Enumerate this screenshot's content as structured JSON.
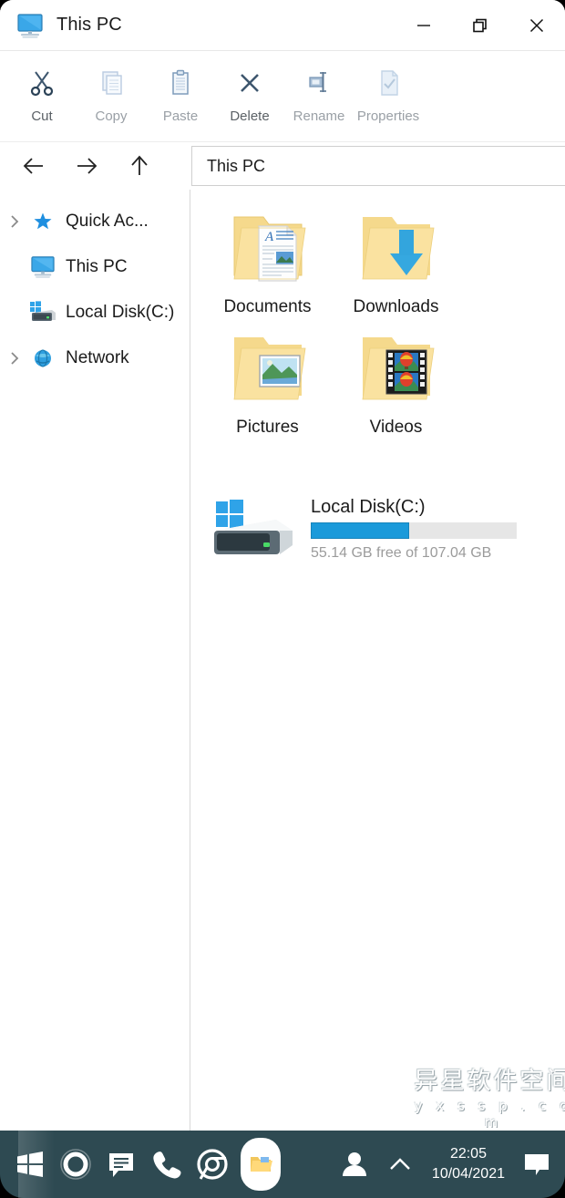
{
  "window": {
    "title": "This PC",
    "title_icon": "this-pc-monitor-icon",
    "controls": {
      "minimize": "minimize-icon",
      "restore": "restore-icon",
      "close": "close-icon"
    }
  },
  "toolbar": {
    "items": [
      {
        "label": "Cut",
        "icon": "scissors-icon",
        "enabled": true
      },
      {
        "label": "Copy",
        "icon": "copy-icon",
        "enabled": false
      },
      {
        "label": "Paste",
        "icon": "clipboard-icon",
        "enabled": false
      },
      {
        "label": "Delete",
        "icon": "x-delete-icon",
        "enabled": true
      },
      {
        "label": "Rename",
        "icon": "rename-icon",
        "enabled": false
      },
      {
        "label": "Properties",
        "icon": "properties-icon",
        "enabled": false
      }
    ]
  },
  "nav": {
    "back": "arrow-left-icon",
    "forward": "arrow-right-icon",
    "up": "arrow-up-icon",
    "address_value": "This PC",
    "address_placeholder": "This PC"
  },
  "sidebar": {
    "items": [
      {
        "label": "Quick Ac...",
        "icon": "star-icon",
        "chevron": true
      },
      {
        "label": "This PC",
        "icon": "monitor-icon",
        "chevron": false
      },
      {
        "label": "Local Disk(C:)",
        "icon": "harddisk-icon",
        "chevron": false
      },
      {
        "label": "Network",
        "icon": "network-icon",
        "chevron": true
      }
    ]
  },
  "content": {
    "folders": [
      {
        "label": "Documents",
        "icon": "folder-documents-icon"
      },
      {
        "label": "Downloads",
        "icon": "folder-downloads-icon"
      },
      {
        "label": "Pictures",
        "icon": "folder-pictures-icon"
      },
      {
        "label": "Videos",
        "icon": "folder-videos-icon"
      }
    ],
    "drives": [
      {
        "name": "Local Disk(C:)",
        "icon": "drive-windows-icon",
        "capacity_text": "55.14 GB free of 107.04 GB",
        "free_gb": 55.14,
        "total_gb": 107.04,
        "used_percent": 48,
        "bar_fill_color": "#1b9ada",
        "bar_track_color": "#e6e6e6"
      }
    ]
  },
  "watermark": {
    "cn": "异星软件空间",
    "en": "y x s s p . c o m"
  },
  "taskbar": {
    "background": "#2e4a52",
    "left_items": [
      {
        "name": "start-button",
        "icon": "windows-logo-icon"
      },
      {
        "name": "cortana-button",
        "icon": "cortana-circle-icon"
      },
      {
        "name": "messages-button",
        "icon": "chat-bubble-icon"
      },
      {
        "name": "phone-button",
        "icon": "phone-icon"
      },
      {
        "name": "browser-button",
        "icon": "chrome-icon"
      },
      {
        "name": "file-explorer-button",
        "icon": "file-explorer-icon"
      }
    ],
    "right_items": [
      {
        "name": "user-account-button",
        "icon": "person-icon"
      },
      {
        "name": "show-hidden-icons",
        "icon": "chevron-up-icon"
      }
    ],
    "clock": {
      "time": "22:05",
      "date": "10/04/2021"
    },
    "notification": {
      "name": "notification-button",
      "icon": "notification-icon"
    }
  }
}
